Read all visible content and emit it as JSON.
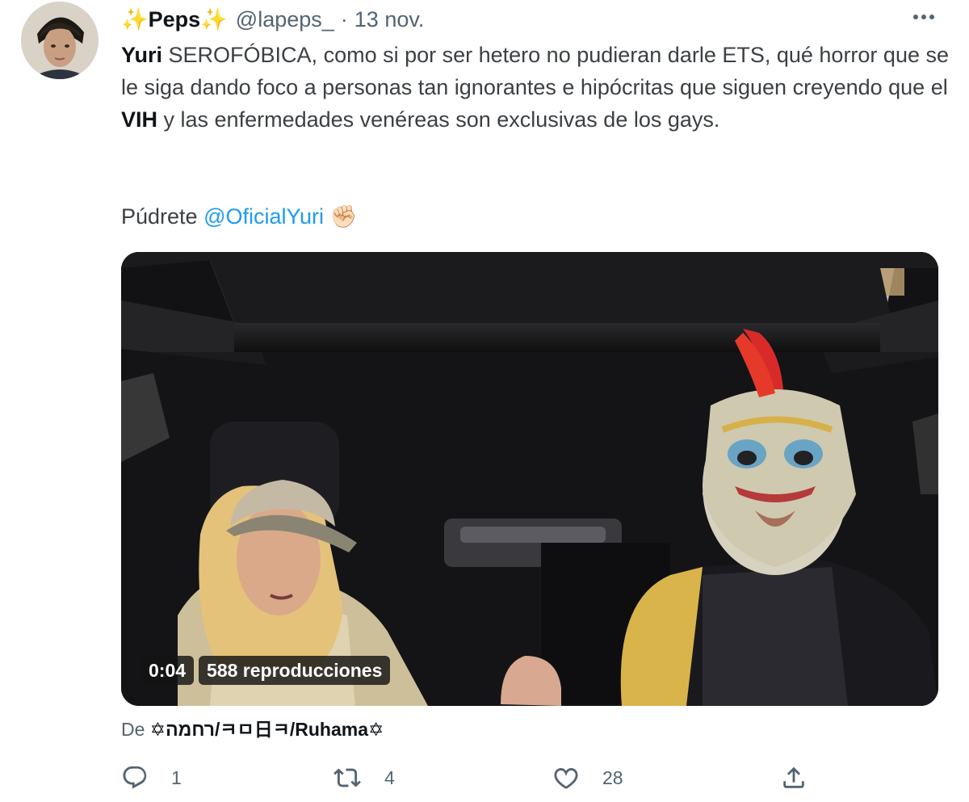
{
  "tweet": {
    "author": {
      "display_name": "✨Peps✨",
      "handle": "@lapeps_",
      "separator": "·",
      "date": "13 nov."
    },
    "text": {
      "part1_bold": "Yuri",
      "part1": " SEROFÓBICA, como si por ser hetero no pudieran darle ETS, qué horror que se le siga dando foco a personas tan ignorantes e hipócritas que siguen creyendo que el ",
      "part1_bold2": "VIH",
      "part1_end": " y las enfermedades venéreas son exclusivas de los gays.",
      "part2": "Púdrete ",
      "mention": "@OficialYuri",
      "emoji": "✊🏻"
    },
    "media": {
      "duration": "0:04",
      "views": "588 reproducciones"
    },
    "source": {
      "prefix": "De ",
      "account": "✡רחמה/ㅋㅁ日ㅋ/Ruhama✡"
    },
    "actions": {
      "replies": "1",
      "retweets": "4",
      "likes": "28"
    }
  },
  "icons": {
    "more": "more-horizontal-icon",
    "reply": "reply-icon",
    "retweet": "retweet-icon",
    "like": "heart-icon",
    "share": "share-icon"
  },
  "colors": {
    "text_primary": "#0f1419",
    "text_secondary": "#536471",
    "link": "#1d9bf0"
  }
}
